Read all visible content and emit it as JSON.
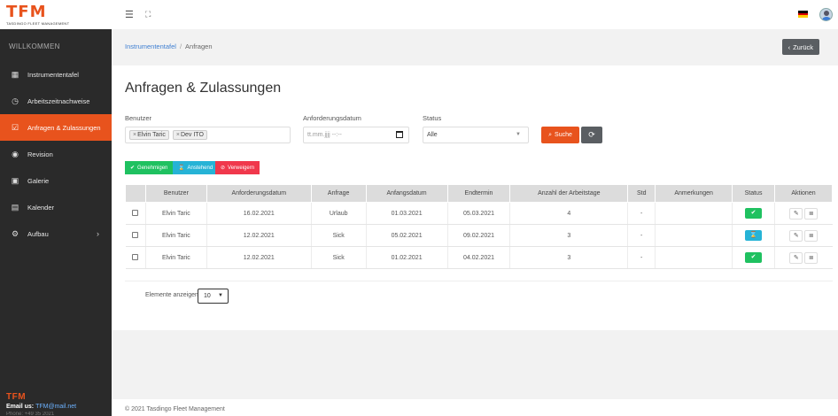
{
  "brand": {
    "logo": "TFM",
    "tagline": "TASDINGO FLEET MANAGEMENT"
  },
  "sidebar": {
    "welcome": "WILLKOMMEN",
    "items": [
      {
        "label": "Instrumententafel",
        "icon": "dashboard-icon"
      },
      {
        "label": "Arbeitszeitnachweise",
        "icon": "clock-icon"
      },
      {
        "label": "Anfragen & Zulassungen",
        "icon": "checkbox-icon",
        "active": true
      },
      {
        "label": "Revision",
        "icon": "eye-icon"
      },
      {
        "label": "Galerie",
        "icon": "image-icon"
      },
      {
        "label": "Kalender",
        "icon": "calendar-icon"
      },
      {
        "label": "Aufbau",
        "icon": "gears-icon"
      }
    ],
    "footer": {
      "logo": "TFM",
      "email_label": "Email us:",
      "email": "TFM@mail.net",
      "phone": "Phone: +49 35 2021"
    }
  },
  "breadcrumb": {
    "home": "Instrumententafel",
    "current": "Anfragen",
    "back_label": "Zurück"
  },
  "page": {
    "title": "Anfragen & Zulassungen"
  },
  "filters": {
    "user_label": "Benutzer",
    "user_tags": [
      "Elvin Taric",
      "Dev ITO"
    ],
    "date_label": "Anforderungsdatum",
    "date_placeholder": "tt.mm.jjjj --:--",
    "status_label": "Status",
    "status_value": "Alle",
    "search_label": "Suche"
  },
  "actions": {
    "approve": "Genehmigen",
    "pending": "Anstehend",
    "reject": "Verweigern"
  },
  "table": {
    "headers": [
      "",
      "Benutzer",
      "Anforderungsdatum",
      "Anfrage",
      "Anfangsdatum",
      "Endtermin",
      "Anzahl der Arbeitstage",
      "Std",
      "Anmerkungen",
      "Status",
      "Aktionen"
    ],
    "rows": [
      {
        "user": "Elvin Taric",
        "req_date": "16.02.2021",
        "type": "Urlaub",
        "start": "01.03.2021",
        "end": "05.03.2021",
        "days": "4",
        "hours": "-",
        "notes": "",
        "status": "approved"
      },
      {
        "user": "Elvin Taric",
        "req_date": "12.02.2021",
        "type": "Sick",
        "start": "05.02.2021",
        "end": "09.02.2021",
        "days": "3",
        "hours": "-",
        "notes": "",
        "status": "pending"
      },
      {
        "user": "Elvin Taric",
        "req_date": "12.02.2021",
        "type": "Sick",
        "start": "01.02.2021",
        "end": "04.02.2021",
        "days": "3",
        "hours": "-",
        "notes": "",
        "status": "approved"
      }
    ]
  },
  "pagination": {
    "label": "Elemente anzeigen",
    "value": "10"
  },
  "footer": {
    "copyright": "© 2021 Tasdingo Fleet Management"
  },
  "colors": {
    "accent": "#e8531d",
    "approve": "#1fc160",
    "pending": "#26b3d6",
    "reject": "#f0384c",
    "sidebar": "#2a2a2a"
  }
}
